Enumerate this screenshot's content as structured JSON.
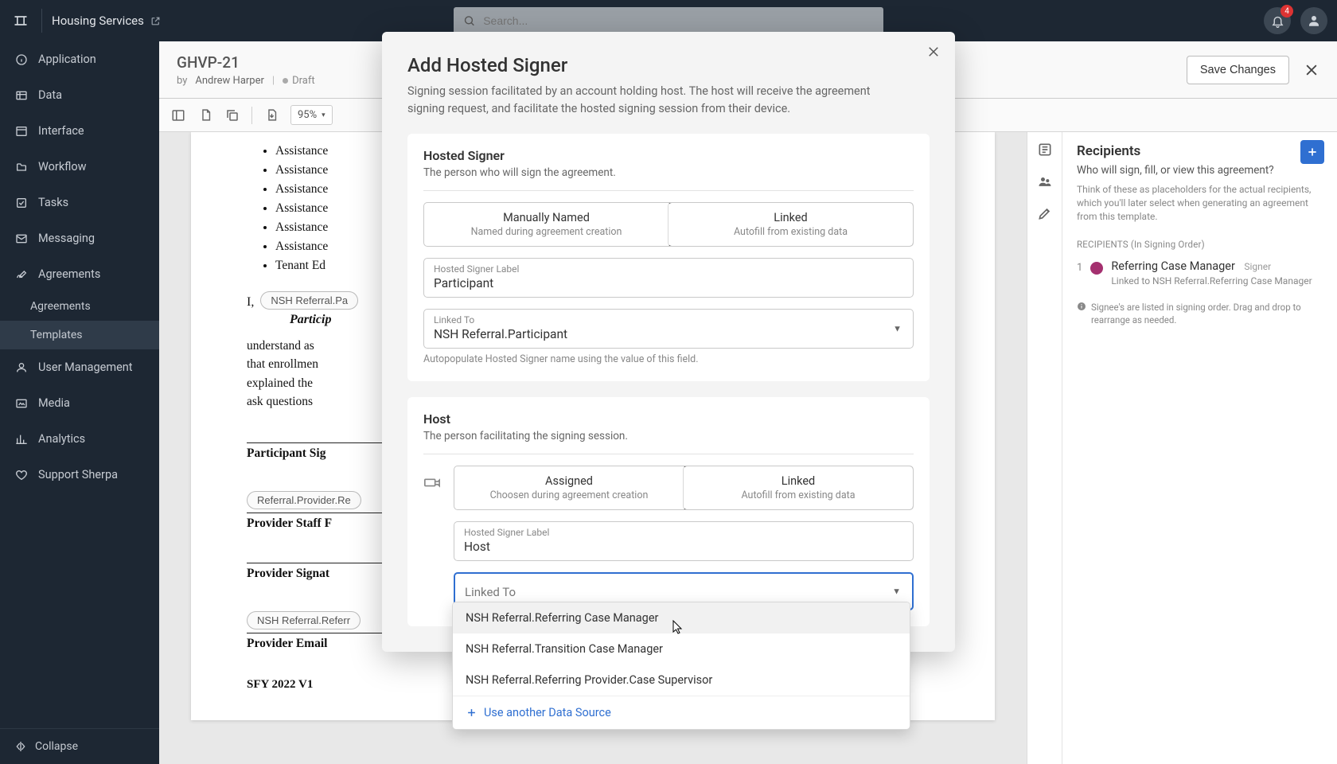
{
  "topbar": {
    "brand": "Housing Services",
    "search_placeholder": "Search...",
    "notification_count": "4"
  },
  "sidebar": {
    "items": [
      {
        "label": "Application"
      },
      {
        "label": "Data"
      },
      {
        "label": "Interface"
      },
      {
        "label": "Workflow"
      },
      {
        "label": "Tasks"
      },
      {
        "label": "Messaging"
      },
      {
        "label": "Agreements",
        "children": [
          {
            "label": "Agreements"
          },
          {
            "label": "Templates"
          }
        ]
      },
      {
        "label": "User Management"
      },
      {
        "label": "Media"
      },
      {
        "label": "Analytics"
      },
      {
        "label": "Support Sherpa"
      }
    ],
    "collapse_label": "Collapse"
  },
  "header": {
    "doc_title": "GHVP-21",
    "by_prefix": "by",
    "author": "Andrew Harper",
    "status": "Draft",
    "save_label": "Save Changes"
  },
  "toolbar": {
    "zoom": "95%"
  },
  "document": {
    "bullets": [
      "Assistance",
      "Assistance",
      "Assistance",
      "Assistance",
      "Assistance",
      "Assistance",
      "Tenant Ed"
    ],
    "i_prefix": "I,",
    "pill_participant": "NSH Referral.Pa",
    "participant_label": "Particip",
    "para": "understand as\nthat enrollmen\nexplained the \nask questions",
    "sig_participant_caption": "Participant Sig",
    "pill_provider": "Referral.Provider.Re",
    "sig_provider_staff_caption": "Provider Staff F",
    "sig_provider_signat_caption": "Provider Signat",
    "pill_referring": "NSH Referral.Referr",
    "sig_provider_email_caption": "Provider Email",
    "footer": "SFY 2022 V1"
  },
  "right_rail": {
    "title": "Recipients",
    "subtitle": "Who will sign, fill, or view this agreement?",
    "hint": "Think of these as placeholders for the actual recipients, which you'll later select when generating an agreement from this template.",
    "section_label": "RECIPIENTS (In Signing Order)",
    "recipients": [
      {
        "index": "1",
        "name": "Referring Case Manager",
        "role": "Signer",
        "linked": "Linked to NSH Referral.Referring Case Manager"
      }
    ],
    "note": "Signee's are listed in signing order. Drag and drop to rearrange as needed."
  },
  "modal": {
    "title": "Add Hosted Signer",
    "description": "Signing session facilitated by an account holding host. The host will receive the agreement signing request, and facilitate the hosted signing session from their device.",
    "signer": {
      "heading": "Hosted Signer",
      "sub": "The person who will sign the agreement.",
      "seg_manual_t1": "Manually Named",
      "seg_manual_t2": "Named during agreement creation",
      "seg_linked_t1": "Linked",
      "seg_linked_t2": "Autofill from existing data",
      "label_field_label": "Hosted Signer Label",
      "label_field_value": "Participant",
      "linked_to_label": "Linked To",
      "linked_to_value": "NSH Referral.Participant",
      "helper": "Autopopulate Hosted Signer name using the value of this field."
    },
    "host": {
      "heading": "Host",
      "sub": "The person facilitating the signing session.",
      "seg_assigned_t1": "Assigned",
      "seg_assigned_t2": "Choosen during agreement creation",
      "seg_linked_t1": "Linked",
      "seg_linked_t2": "Autofill from existing data",
      "label_field_label": "Hosted Signer Label",
      "label_field_value": "Host",
      "linked_to_label": "Linked To",
      "options": [
        "NSH Referral.Referring Case Manager",
        "NSH Referral.Transition Case Manager",
        "NSH Referral.Referring Provider.Case Supervisor"
      ],
      "add_source": "Use another Data Source"
    }
  }
}
